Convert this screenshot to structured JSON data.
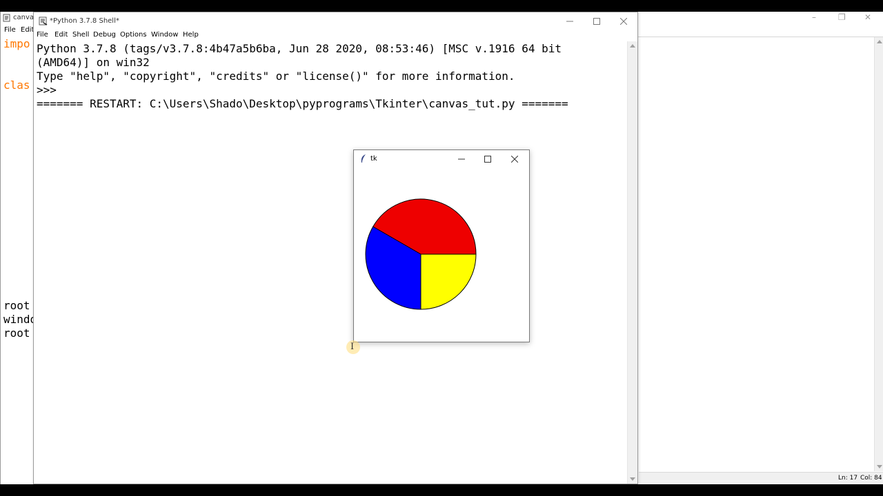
{
  "editor": {
    "title": "canvas",
    "menu": [
      "File",
      "Edit"
    ],
    "code_fragments": [
      {
        "text": "impo",
        "color": "#ff7700"
      },
      {
        "text": "clas",
        "color": "#ff7700"
      },
      {
        "text": "root",
        "color": "#000000"
      },
      {
        "text": "windo",
        "color": "#000000"
      },
      {
        "text": "root",
        "color": "#000000"
      }
    ],
    "status": {
      "line": "Ln: 17",
      "col": "Col: 84"
    }
  },
  "shell": {
    "title": "*Python 3.7.8 Shell*",
    "menu": [
      "File",
      "Edit",
      "Shell",
      "Debug",
      "Options",
      "Window",
      "Help"
    ],
    "lines": [
      "Python 3.7.8 (tags/v3.7.8:4b47a5b6ba, Jun 28 2020, 08:53:46) [MSC v.1916 64 bit",
      "(AMD64)] on win32",
      "Type \"help\", \"copyright\", \"credits\" or \"license()\" for more information.",
      ">>> ",
      "======= RESTART: C:\\Users\\Shado\\Desktop\\pyprograms\\Tkinter\\canvas_tut.py ======="
    ]
  },
  "tk_window": {
    "title": "tk",
    "pie": {
      "slices": [
        {
          "color": "red",
          "hex": "#ee0000",
          "start_deg": 0,
          "extent_deg": 150
        },
        {
          "color": "blue",
          "hex": "#0000ff",
          "start_deg": 150,
          "extent_deg": 120
        },
        {
          "color": "yellow",
          "hex": "#ffff00",
          "start_deg": 270,
          "extent_deg": 90
        }
      ]
    }
  },
  "icons": {
    "window_minimize": "minimize-icon",
    "window_maximize": "maximize-icon",
    "window_close": "close-icon",
    "feather": "tk-feather-icon",
    "idle": "idle-icon"
  }
}
